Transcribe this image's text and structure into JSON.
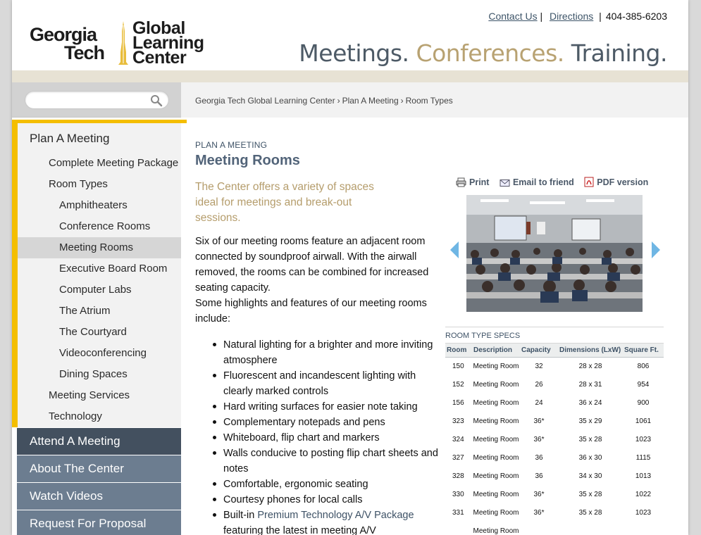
{
  "header": {
    "logo_gt": [
      "Georgia",
      "Tech"
    ],
    "logo_glc": [
      "Global",
      "Learning",
      "Center"
    ],
    "links": {
      "contact": "Contact Us",
      "directions": "Directions",
      "phone": "404-385-6203"
    },
    "tagline": [
      "Meetings.",
      "Conferences.",
      "Training."
    ]
  },
  "search": {
    "placeholder": "",
    "value": ""
  },
  "breadcrumb": [
    "Georgia Tech Global Learning Center",
    "Plan A Meeting",
    "Room Types"
  ],
  "breadcrumb_sep": "›",
  "sidebar": {
    "plan": [
      {
        "label": "Plan A Meeting"
      },
      {
        "label": "Complete Meeting Package"
      },
      {
        "label": "Room Types"
      },
      {
        "label": "Amphitheaters"
      },
      {
        "label": "Conference Rooms"
      },
      {
        "label": "Meeting Rooms"
      },
      {
        "label": "Executive Board Room"
      },
      {
        "label": "Computer Labs"
      },
      {
        "label": "The Atrium"
      },
      {
        "label": "The Courtyard"
      },
      {
        "label": "Videoconferencing"
      },
      {
        "label": "Dining Spaces"
      },
      {
        "label": "Meeting Services"
      },
      {
        "label": "Technology"
      }
    ],
    "sections": [
      "Attend A Meeting",
      "About The Center",
      "Watch Videos",
      "Request For Proposal"
    ]
  },
  "main": {
    "kicker": "PLAN A MEETING",
    "title": "Meeting Rooms",
    "lede": "The Center offers a variety of spaces ideal for meetings and break-out sessions.",
    "body": [
      "Six of our meeting rooms feature an adjacent room connected by soundproof airwall. With the airwall removed, the rooms can be combined for increased seating capacity.",
      "Some highlights and features of our meeting rooms include:"
    ],
    "bullets": [
      "Natural lighting for a brighter and more inviting atmosphere",
      "Fluorescent and incandescent lighting with clearly marked controls",
      "Hard writing surfaces for easier note taking",
      "Complementary notepads and pens",
      "Whiteboard, flip chart and markers",
      "Walls conducive to posting flip chart sheets and notes",
      "Comfortable, ergonomic seating",
      "Courtesy phones for local calls"
    ],
    "last_bullet": {
      "pre": "Built-in",
      "link": "Premium Technology A/V Package",
      "post": "featuring the latest in meeting A/V"
    },
    "tools": {
      "print": "Print",
      "email": "Email to friend",
      "pdf": "PDF version"
    }
  },
  "specs": {
    "title": "ROOM TYPE SPECS",
    "headers": [
      "Room",
      "Description",
      "Capacity",
      "Dimensions (LxW)",
      "Square Ft."
    ],
    "rows": [
      [
        "150",
        "Meeting Room",
        "32",
        "28 x 28",
        "806"
      ],
      [
        "152",
        "Meeting Room",
        "26",
        "28 x 31",
        "954"
      ],
      [
        "156",
        "Meeting Room",
        "24",
        "36 x 24",
        "900"
      ],
      [
        "323",
        "Meeting Room",
        "36*",
        "35 x 29",
        "1061"
      ],
      [
        "324",
        "Meeting Room",
        "36*",
        "35 x 28",
        "1023"
      ],
      [
        "327",
        "Meeting Room",
        "36",
        "36 x 30",
        "1115"
      ],
      [
        "328",
        "Meeting Room",
        "36",
        "34 x 30",
        "1013"
      ],
      [
        "330",
        "Meeting Room",
        "36*",
        "35 x 28",
        "1022"
      ],
      [
        "331",
        "Meeting Room",
        "36*",
        "35 x 28",
        "1023"
      ],
      [
        "",
        "Meeting Room",
        "",
        "",
        ""
      ]
    ]
  },
  "colors": {
    "gold": "#f4be00",
    "tan": "#b59d6c",
    "slate": "#4d5a66",
    "nav_dark": "#43505f",
    "nav_mid": "#6c7d90",
    "link": "#3e5266"
  }
}
